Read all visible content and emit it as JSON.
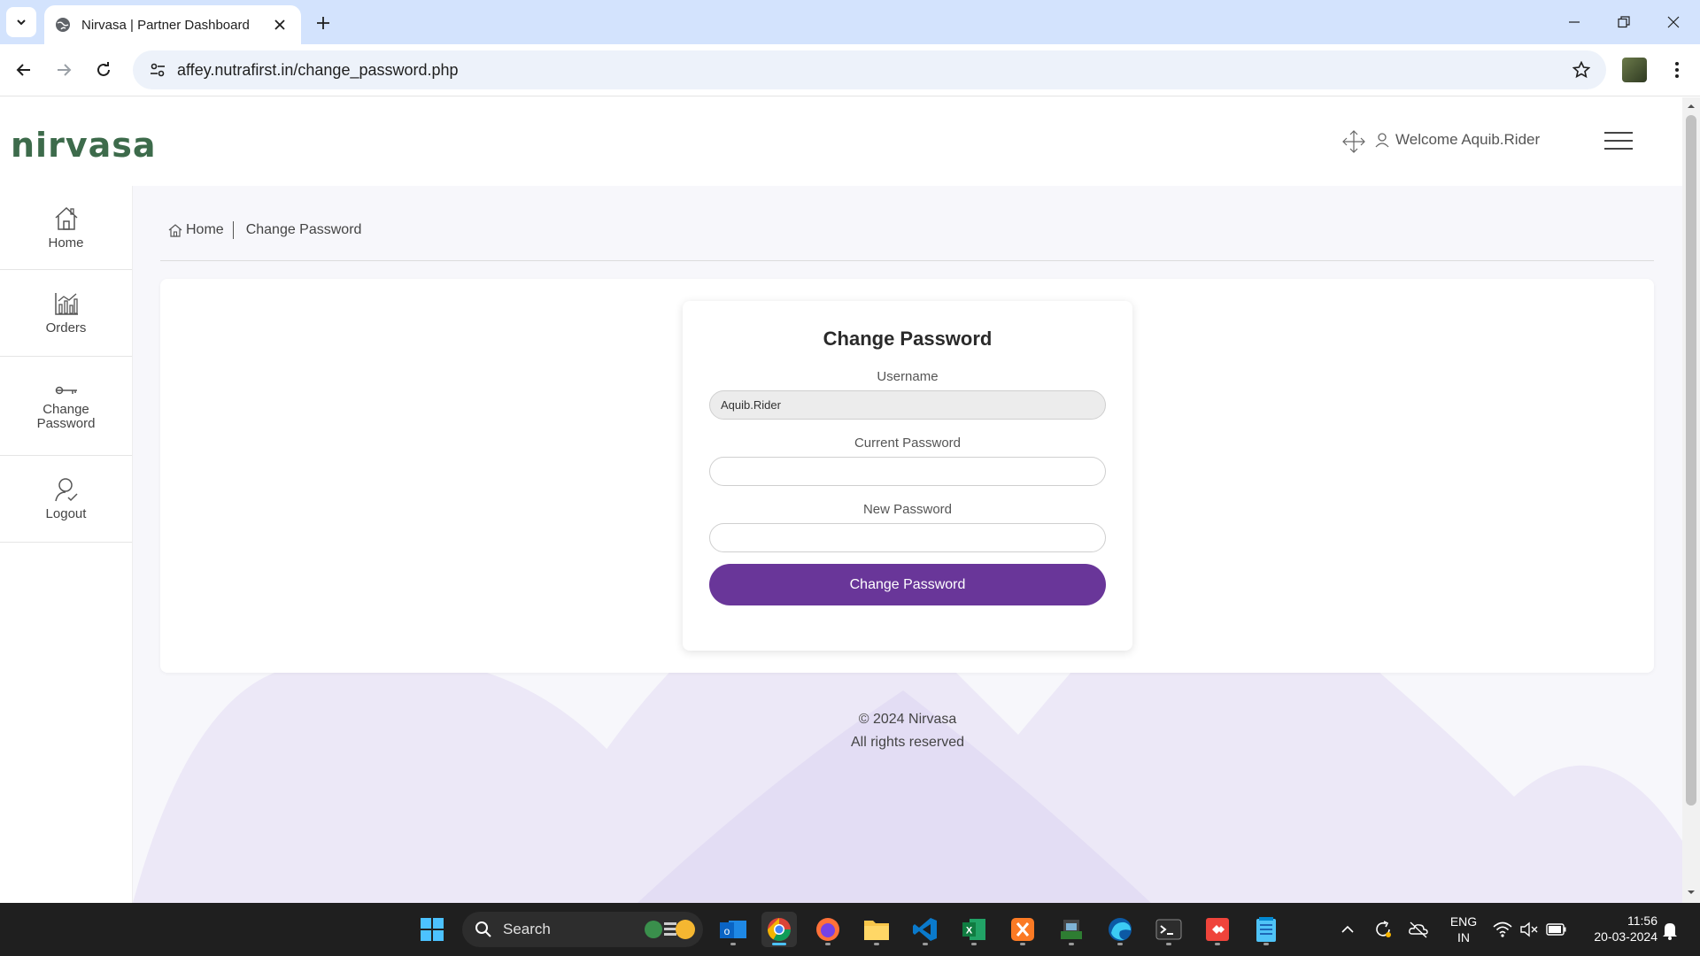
{
  "browser": {
    "tab_title": "Nirvasa | Partner Dashboard",
    "url": "affey.nutrafirst.in/change_password.php"
  },
  "header": {
    "logo_text": "nirvasa",
    "welcome_text": "Welcome Aquib.Rider"
  },
  "sidebar": {
    "items": [
      {
        "label": "Home",
        "icon": "home-icon"
      },
      {
        "label": "Orders",
        "icon": "chart-icon"
      },
      {
        "label": "Change Password",
        "icon": "key-icon"
      },
      {
        "label": "Logout",
        "icon": "logout-user-icon"
      }
    ]
  },
  "breadcrumb": {
    "home": "Home",
    "current": "Change Password"
  },
  "form": {
    "title": "Change Password",
    "username_label": "Username",
    "username_value": "Aquib.Rider",
    "current_password_label": "Current Password",
    "current_password_value": "",
    "new_password_label": "New Password",
    "new_password_value": "",
    "submit_label": "Change Password"
  },
  "footer": {
    "copyright": "© 2024 Nirvasa",
    "rights": "All rights reserved"
  },
  "taskbar": {
    "search_placeholder": "Search",
    "language_line1": "ENG",
    "language_line2": "IN",
    "time": "11:56",
    "date": "20-03-2024"
  },
  "colors": {
    "accent": "#693699",
    "logo": "#3d6b4b",
    "tabbar": "#d3e3fd"
  }
}
